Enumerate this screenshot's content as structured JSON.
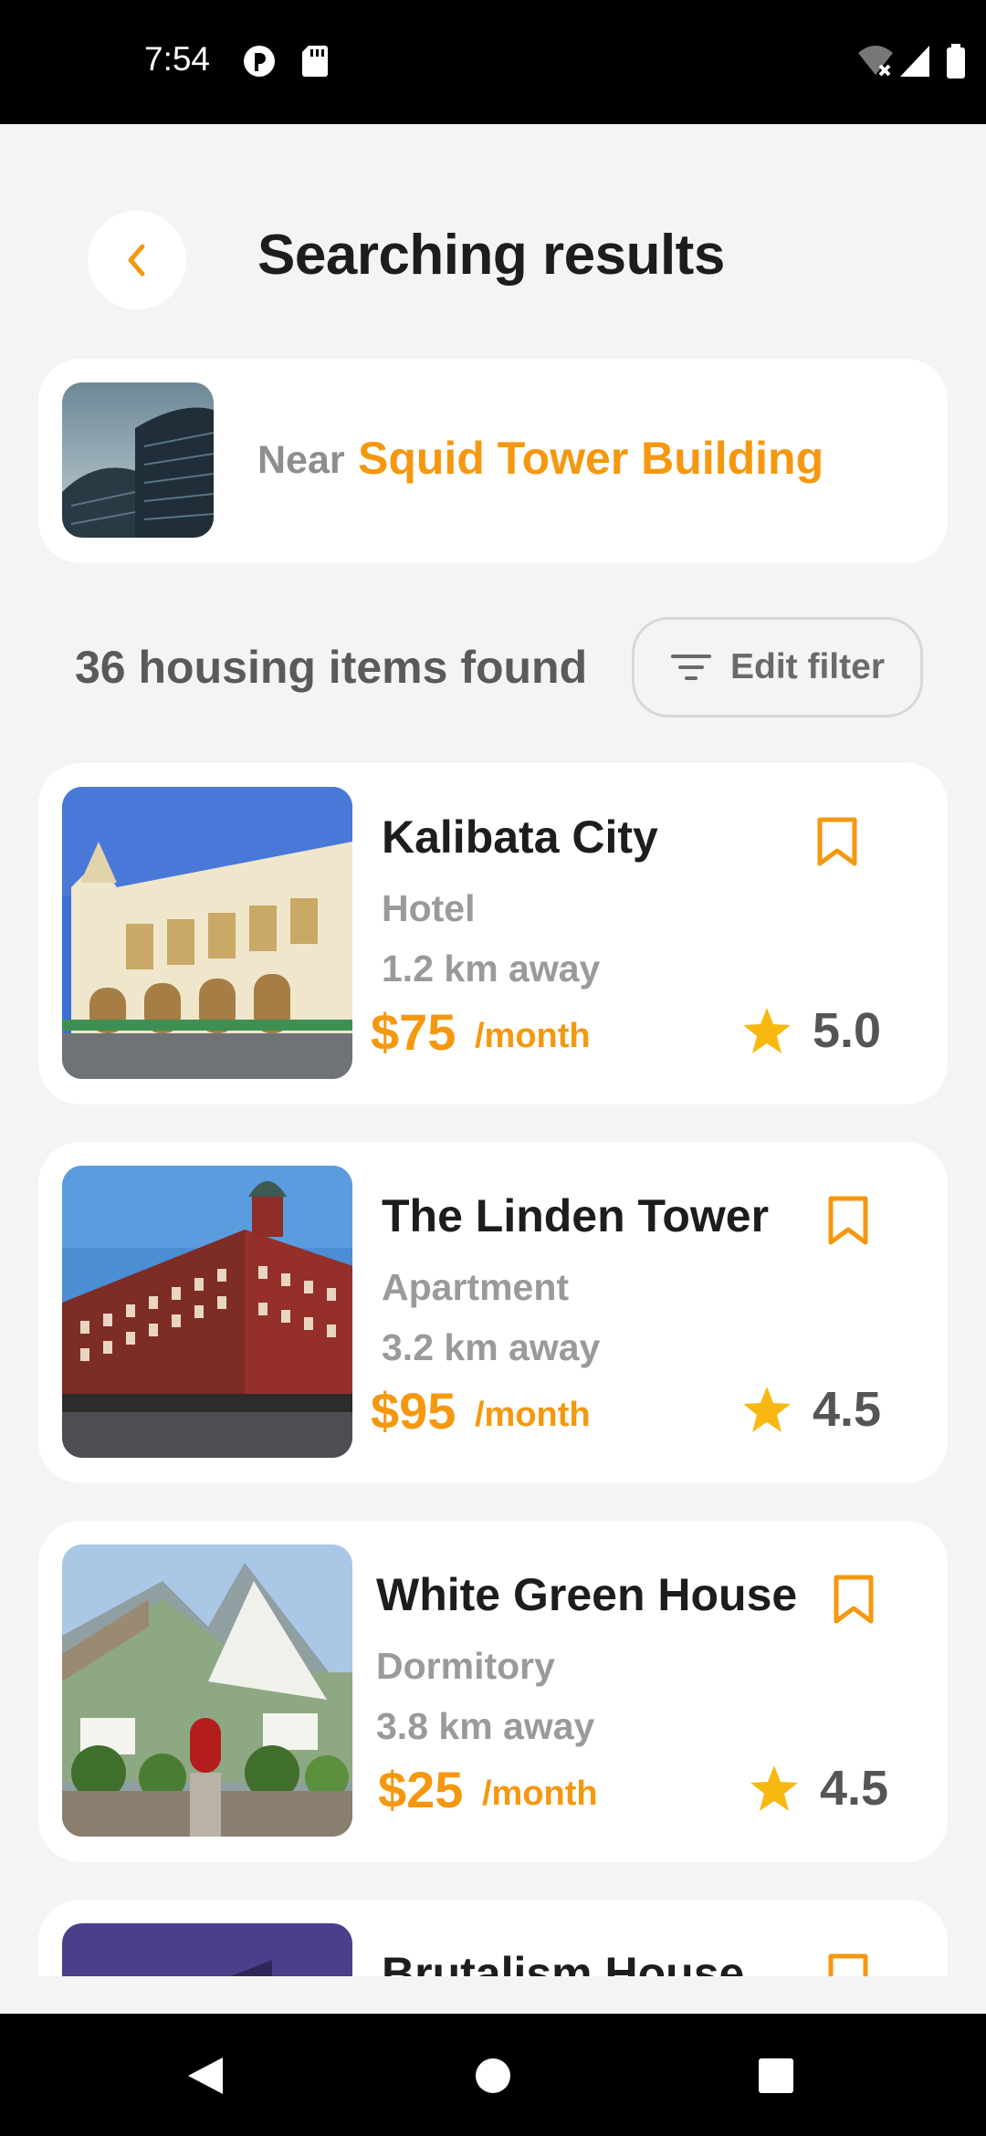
{
  "status": {
    "time": "7:54"
  },
  "header": {
    "title": "Searching results"
  },
  "location": {
    "near_label": "Near",
    "place": "Squid Tower Building"
  },
  "results": {
    "count_text": "36 housing items found",
    "filter_label": "Edit filter"
  },
  "colors": {
    "accent": "#f5980f",
    "star": "#f9b811",
    "background": "#f4f4f4"
  },
  "listings": [
    {
      "name": "Kalibata City",
      "type": "Hotel",
      "distance": "1.2 km away",
      "price": "$75",
      "period": "/month",
      "rating": "5.0"
    },
    {
      "name": "The Linden Tower",
      "type": "Apartment",
      "distance": "3.2 km away",
      "price": "$95",
      "period": "/month",
      "rating": "4.5"
    },
    {
      "name": "White Green House",
      "type": "Dormitory",
      "distance": "3.8 km away",
      "price": "$25",
      "period": "/month",
      "rating": "4.5"
    },
    {
      "name": "Brutalism House",
      "type": "",
      "distance": "",
      "price": "",
      "period": "",
      "rating": ""
    }
  ],
  "icons": {
    "back": "chevron-left-icon",
    "filter": "filter-lines-icon",
    "bookmark": "bookmark-icon",
    "star": "star-icon"
  }
}
